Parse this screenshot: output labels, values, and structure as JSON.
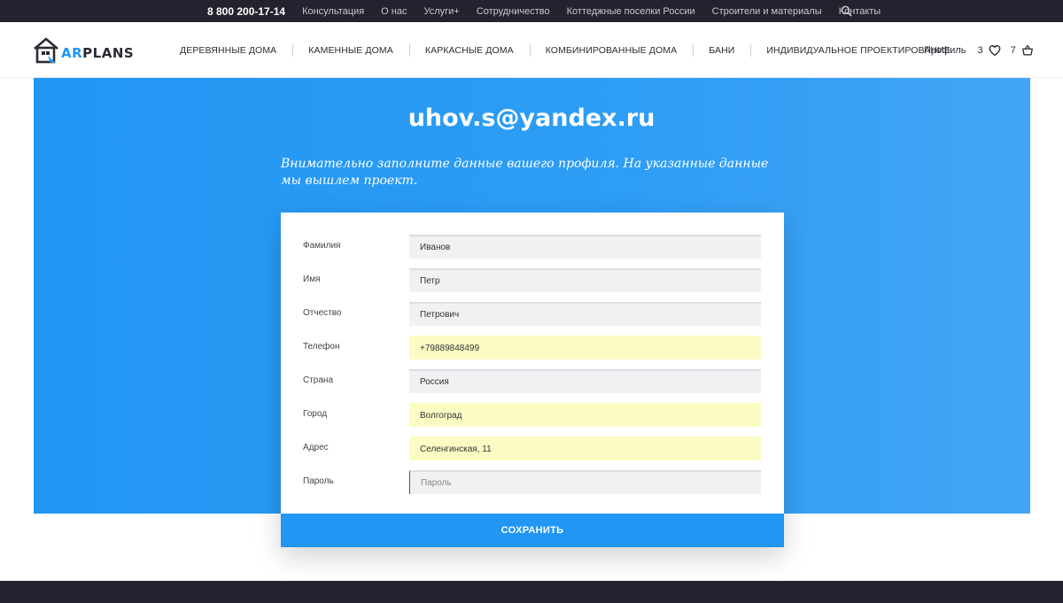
{
  "topbar": {
    "phone": "8 800 200-17-14",
    "links": [
      "Консультация",
      "О нас",
      "Услуги+",
      "Сотрудничество",
      "Коттеджные поселки России",
      "Строители и материалы",
      "Контакты"
    ]
  },
  "header": {
    "logo": {
      "prefix": "AR",
      "suffix": "PLANS"
    },
    "nav": [
      "ДЕРЕВЯННЫЕ ДОМА",
      "КАМЕННЫЕ ДОМА",
      "КАРКАСНЫЕ ДОМА",
      "КОМБИНИРОВАННЫЕ ДОМА",
      "БАНИ",
      "ИНДИВИДУАЛЬНОЕ ПРОЕКТИРОВАНИЕ"
    ],
    "profile_label": "Профиль",
    "favorites_count": "3",
    "cart_count": "7"
  },
  "hero": {
    "email": "uhov.s@yandex.ru",
    "intro": "Внимательно заполните данные вашего профиля. На указанные данные мы вышлем проект."
  },
  "form": {
    "fields": [
      {
        "label": "Фамилия",
        "value": "Иванов",
        "placeholder": ""
      },
      {
        "label": "Имя",
        "value": "Петр",
        "placeholder": ""
      },
      {
        "label": "Отчество",
        "value": "Петрович",
        "placeholder": ""
      },
      {
        "label": "Телефон",
        "value": "+79889848499",
        "placeholder": ""
      },
      {
        "label": "Страна",
        "value": "Россия",
        "placeholder": ""
      },
      {
        "label": "Город",
        "value": "Волгоград",
        "placeholder": ""
      },
      {
        "label": "Адрес",
        "value": "Селенгинская, 11",
        "placeholder": ""
      },
      {
        "label": "Пароль",
        "value": "",
        "placeholder": "Пароль"
      }
    ],
    "save_label": "СОХРАНИТЬ"
  },
  "colors": {
    "accent": "#2196f3",
    "dark": "#23222e",
    "autofill": "#fbfcc4"
  }
}
